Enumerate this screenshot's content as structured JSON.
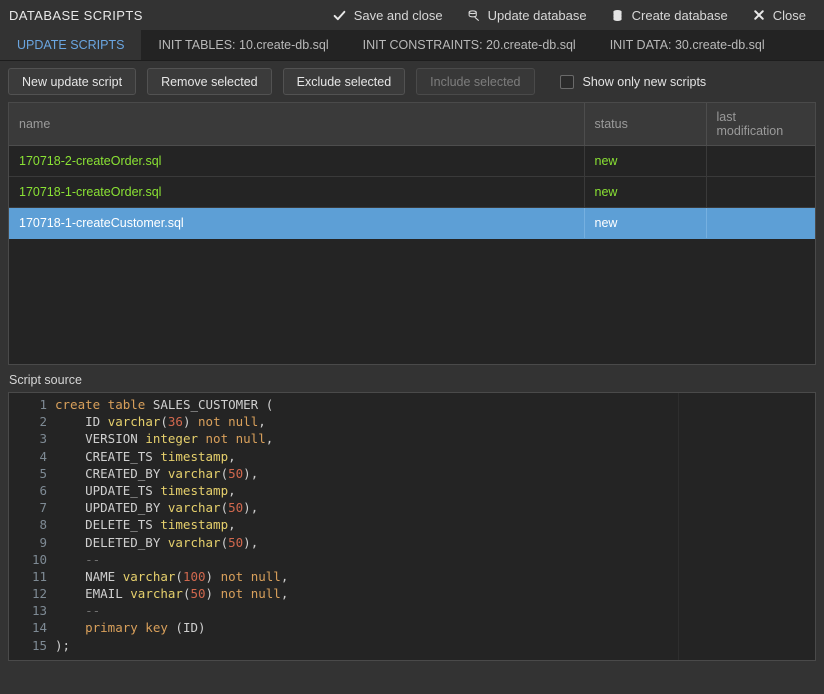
{
  "window": {
    "title": "DATABASE SCRIPTS"
  },
  "toolbar": {
    "actions": [
      {
        "label": "Save and close",
        "icon": "check-icon",
        "glyph": "✔"
      },
      {
        "label": "Update database",
        "icon": "update-database-icon",
        "glyph": "☷"
      },
      {
        "label": "Create database",
        "icon": "create-database-icon",
        "glyph": "☰"
      },
      {
        "label": "Close",
        "icon": "close-icon",
        "glyph": "✖"
      }
    ]
  },
  "tabs": [
    {
      "label": "UPDATE SCRIPTS",
      "active": true
    },
    {
      "label": "INIT TABLES: 10.create-db.sql",
      "active": false
    },
    {
      "label": "INIT CONSTRAINTS: 20.create-db.sql",
      "active": false
    },
    {
      "label": "INIT DATA: 30.create-db.sql",
      "active": false
    }
  ],
  "actions": {
    "new_update_script": "New update script",
    "remove_selected": "Remove selected",
    "exclude_selected": "Exclude selected",
    "include_selected": "Include selected",
    "show_only_new_scripts": "Show only new scripts",
    "show_only_new_scripts_checked": false
  },
  "table": {
    "columns": [
      "name",
      "status",
      "last modification"
    ],
    "rows": [
      {
        "name": "170718-2-createOrder.sql",
        "status": "new",
        "last_modification": "",
        "selected": false
      },
      {
        "name": "170718-1-createOrder.sql",
        "status": "new",
        "last_modification": "",
        "selected": false
      },
      {
        "name": "170718-1-createCustomer.sql",
        "status": "new",
        "last_modification": "",
        "selected": true
      }
    ]
  },
  "script_source": {
    "label": "Script source",
    "lines": [
      {
        "n": "1",
        "tokens": [
          {
            "t": "create table ",
            "c": "t-kw"
          },
          {
            "t": "SALES_CUSTOMER ",
            "c": "t-id"
          },
          {
            "t": "(",
            "c": "t-pun"
          }
        ]
      },
      {
        "n": "2",
        "tokens": [
          {
            "t": "    ID ",
            "c": "t-id"
          },
          {
            "t": "varchar",
            "c": "t-typ"
          },
          {
            "t": "(",
            "c": "t-pun"
          },
          {
            "t": "36",
            "c": "t-num"
          },
          {
            "t": ") ",
            "c": "t-pun"
          },
          {
            "t": "not null",
            "c": "t-kw"
          },
          {
            "t": ",",
            "c": "t-pun"
          }
        ]
      },
      {
        "n": "3",
        "tokens": [
          {
            "t": "    VERSION ",
            "c": "t-id"
          },
          {
            "t": "integer ",
            "c": "t-typ"
          },
          {
            "t": "not null",
            "c": "t-kw"
          },
          {
            "t": ",",
            "c": "t-pun"
          }
        ]
      },
      {
        "n": "4",
        "tokens": [
          {
            "t": "    CREATE_TS ",
            "c": "t-id"
          },
          {
            "t": "timestamp",
            "c": "t-typ"
          },
          {
            "t": ",",
            "c": "t-pun"
          }
        ]
      },
      {
        "n": "5",
        "tokens": [
          {
            "t": "    CREATED_BY ",
            "c": "t-id"
          },
          {
            "t": "varchar",
            "c": "t-typ"
          },
          {
            "t": "(",
            "c": "t-pun"
          },
          {
            "t": "50",
            "c": "t-num"
          },
          {
            "t": "),",
            "c": "t-pun"
          }
        ]
      },
      {
        "n": "6",
        "tokens": [
          {
            "t": "    UPDATE_TS ",
            "c": "t-id"
          },
          {
            "t": "timestamp",
            "c": "t-typ"
          },
          {
            "t": ",",
            "c": "t-pun"
          }
        ]
      },
      {
        "n": "7",
        "tokens": [
          {
            "t": "    UPDATED_BY ",
            "c": "t-id"
          },
          {
            "t": "varchar",
            "c": "t-typ"
          },
          {
            "t": "(",
            "c": "t-pun"
          },
          {
            "t": "50",
            "c": "t-num"
          },
          {
            "t": "),",
            "c": "t-pun"
          }
        ]
      },
      {
        "n": "8",
        "tokens": [
          {
            "t": "    DELETE_TS ",
            "c": "t-id"
          },
          {
            "t": "timestamp",
            "c": "t-typ"
          },
          {
            "t": ",",
            "c": "t-pun"
          }
        ]
      },
      {
        "n": "9",
        "tokens": [
          {
            "t": "    DELETED_BY ",
            "c": "t-id"
          },
          {
            "t": "varchar",
            "c": "t-typ"
          },
          {
            "t": "(",
            "c": "t-pun"
          },
          {
            "t": "50",
            "c": "t-num"
          },
          {
            "t": "),",
            "c": "t-pun"
          }
        ]
      },
      {
        "n": "10",
        "tokens": [
          {
            "t": "    --",
            "c": "t-com"
          }
        ]
      },
      {
        "n": "11",
        "tokens": [
          {
            "t": "    NAME ",
            "c": "t-id"
          },
          {
            "t": "varchar",
            "c": "t-typ"
          },
          {
            "t": "(",
            "c": "t-pun"
          },
          {
            "t": "100",
            "c": "t-num"
          },
          {
            "t": ") ",
            "c": "t-pun"
          },
          {
            "t": "not null",
            "c": "t-kw"
          },
          {
            "t": ",",
            "c": "t-pun"
          }
        ]
      },
      {
        "n": "12",
        "tokens": [
          {
            "t": "    EMAIL ",
            "c": "t-id"
          },
          {
            "t": "varchar",
            "c": "t-typ"
          },
          {
            "t": "(",
            "c": "t-pun"
          },
          {
            "t": "50",
            "c": "t-num"
          },
          {
            "t": ") ",
            "c": "t-pun"
          },
          {
            "t": "not null",
            "c": "t-kw"
          },
          {
            "t": ",",
            "c": "t-pun"
          }
        ]
      },
      {
        "n": "13",
        "tokens": [
          {
            "t": "    --",
            "c": "t-com"
          }
        ]
      },
      {
        "n": "14",
        "tokens": [
          {
            "t": "    primary key ",
            "c": "t-kw"
          },
          {
            "t": "(ID)",
            "c": "t-pun"
          }
        ]
      },
      {
        "n": "15",
        "tokens": [
          {
            "t": ");",
            "c": "t-pun"
          }
        ]
      }
    ]
  },
  "colors": {
    "accent_tab": "#6aa5e0",
    "selection": "#5d9fd6",
    "status_new": "#8ae234",
    "background": "#333333",
    "panel": "#242424"
  }
}
